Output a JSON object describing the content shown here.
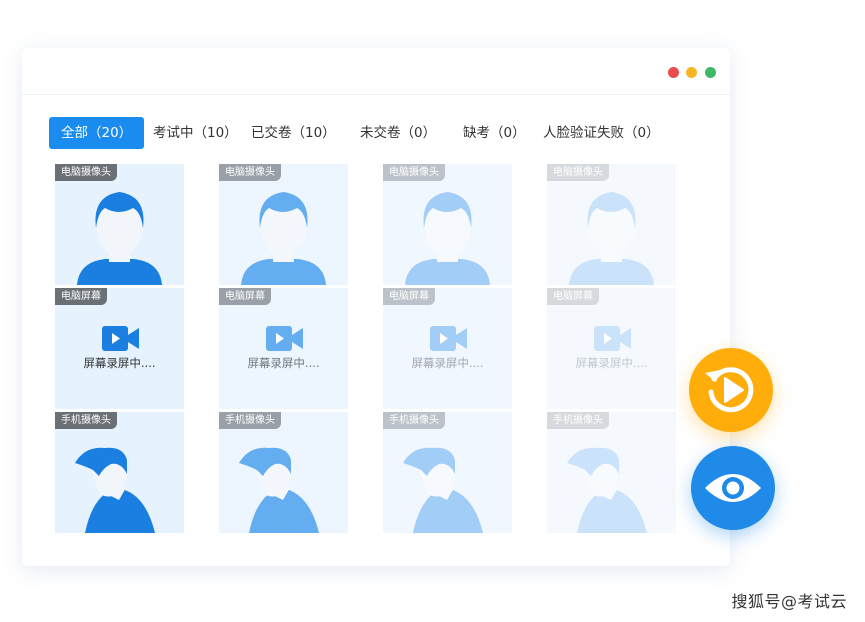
{
  "window": {
    "traffic_lights": [
      "#e84c4c",
      "#f5b626",
      "#3fb865"
    ]
  },
  "tabs": [
    {
      "label": "全部（20）",
      "active": true
    },
    {
      "label": "考试中（10）",
      "active": false
    },
    {
      "label": "已交卷（10）",
      "active": false
    },
    {
      "label": "未交卷（0）",
      "active": false
    },
    {
      "label": "缺考（0）",
      "active": false
    },
    {
      "label": "人脸验证失败（0）",
      "active": false
    }
  ],
  "monitor": {
    "row_labels": [
      "电脑摄像头",
      "电脑屏幕",
      "手机摄像头"
    ],
    "recording_text": "屏幕录屏中....",
    "columns": [
      {
        "tone": "primary"
      },
      {
        "tone": "medium"
      },
      {
        "tone": "light"
      },
      {
        "tone": "faint"
      }
    ]
  },
  "actions": {
    "replay_icon": "replay-icon",
    "view_icon": "eye-icon",
    "replay_color": "#ffad0a",
    "view_color": "#1f8ae8"
  },
  "watermark": "搜狐号@考试云"
}
